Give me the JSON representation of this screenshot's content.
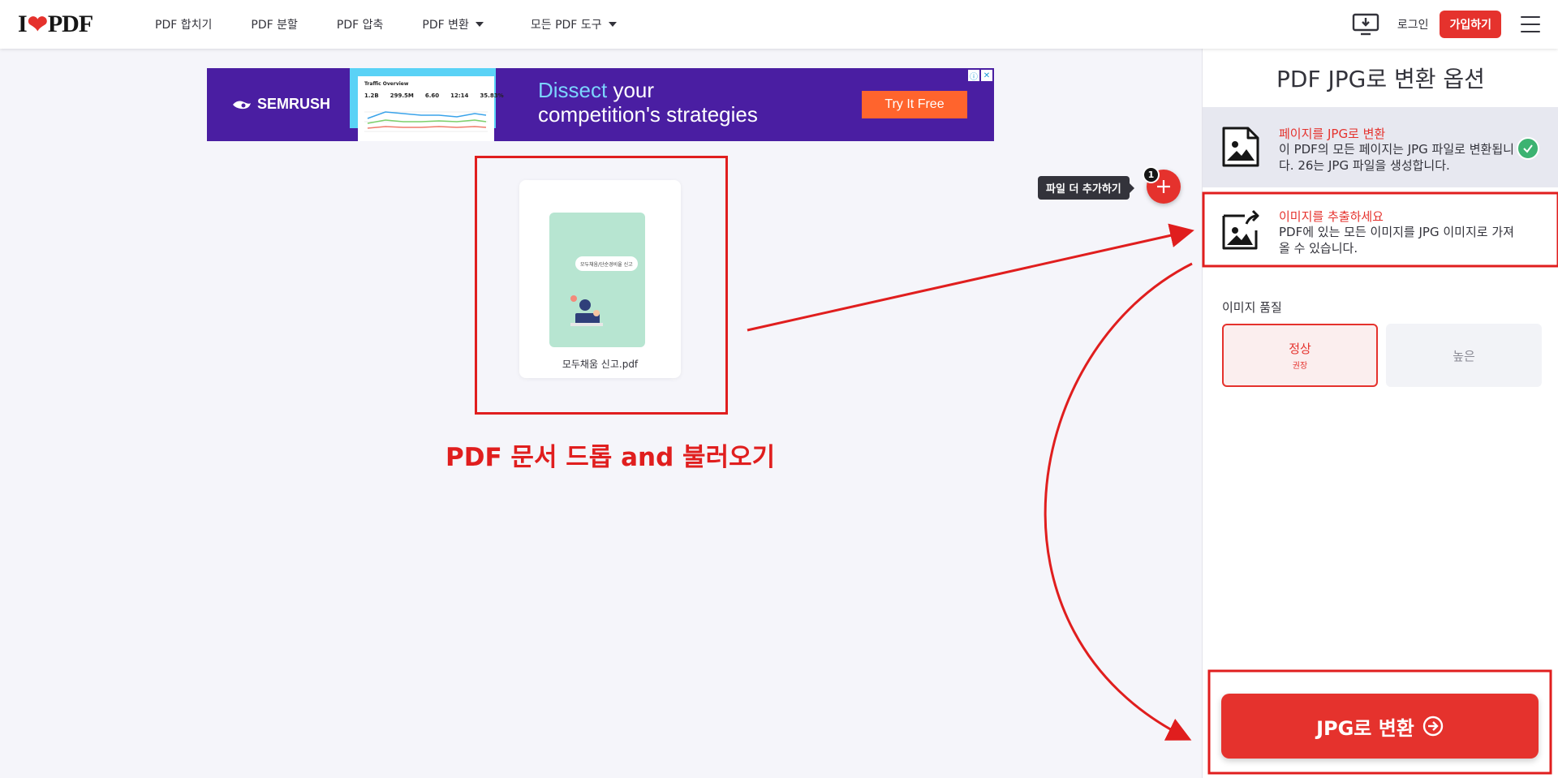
{
  "header": {
    "logo_prefix": "I",
    "logo_suffix": "PDF",
    "nav": [
      {
        "label": "PDF 합치기",
        "dropdown": false
      },
      {
        "label": "PDF 분할",
        "dropdown": false
      },
      {
        "label": "PDF 압축",
        "dropdown": false
      },
      {
        "label": "PDF 변환",
        "dropdown": true
      },
      {
        "label": "모든 PDF 도구",
        "dropdown": true
      }
    ],
    "login": "로그인",
    "signup": "가입하기"
  },
  "ad": {
    "brand": "SEMRUSH",
    "card_title": "Traffic Overview",
    "card_stats": [
      "1.2B",
      "299.5M",
      "6.60",
      "12:14",
      "35.83%"
    ],
    "headline_highlight": "Dissect",
    "headline_rest": " your",
    "headline_line2": "competition's strategies",
    "cta": "Try It Free"
  },
  "file": {
    "name": "모두채움 신고.pdf",
    "thumb_text": "모두채움/단순경비율 신고"
  },
  "add_files": {
    "tooltip": "파일 더 추가하기",
    "count": "1"
  },
  "annotation": {
    "label": "PDF 문서 드롭 and 불러오기"
  },
  "sidebar": {
    "title": "PDF JPG로 변환 옵션",
    "options": [
      {
        "title": "페이지를 JPG로 변환",
        "desc": "이 PDF의 모든 페이지는 JPG 파일로 변환됩니다. 26는 JPG 파일을 생성합니다.",
        "selected": true
      },
      {
        "title": "이미지를 추출하세요",
        "desc": "PDF에 있는 모든 이미지를 JPG 이미지로 가져올 수 있습니다.",
        "selected": false
      }
    ],
    "quality_label": "이미지 품질",
    "quality": {
      "normal": "정상",
      "normal_sub": "권장",
      "high": "높은",
      "selected": "normal"
    },
    "convert_button": "JPG로 변환"
  },
  "colors": {
    "brand_red": "#e5322d",
    "annotation_red": "#e01e1e",
    "check_green": "#3cb371",
    "ad_purple": "#4a1ea2",
    "ad_orange": "#ff642d"
  }
}
